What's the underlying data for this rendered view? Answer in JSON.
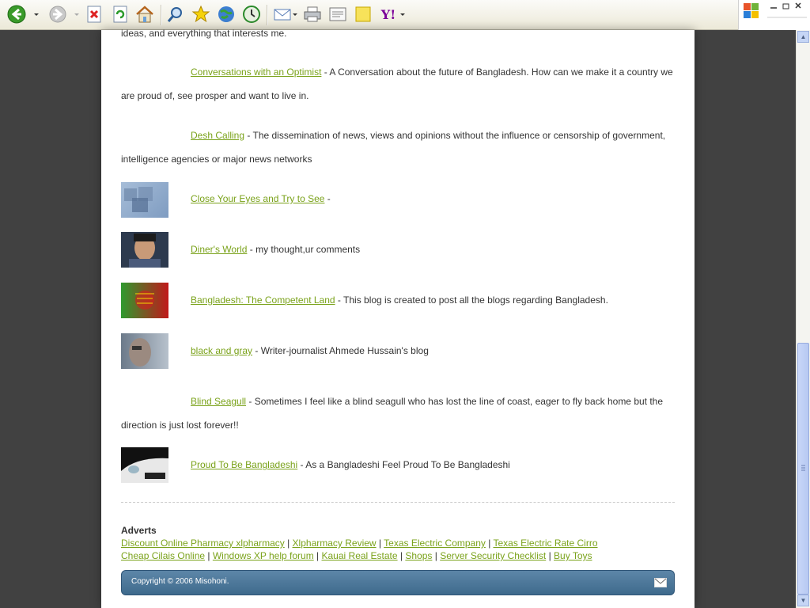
{
  "toolbar": {
    "buttons": [
      "back-icon",
      "forward-icon",
      "stop-icon",
      "refresh-icon",
      "home-icon",
      "search-icon",
      "favorites-icon",
      "media-icon",
      "history-icon",
      "mail-icon",
      "print-icon",
      "edit-icon",
      "notes-icon",
      "yahoo-icon"
    ],
    "yahoo_label": "Y!"
  },
  "cut_text": "ideas, and everything that interests me.",
  "blogs": [
    {
      "title": "Conversations with an Optimist",
      "desc": " - A Conversation about the future of Bangladesh. How can we make it a country we are proud of, see prosper and want to live in.",
      "thumb": ""
    },
    {
      "title": "Desh Calling",
      "desc": " - The dissemination of news, views and opinions without the influence or censorship of government, intelligence agencies or major news networks",
      "thumb": ""
    },
    {
      "title": "Close Your Eyes and Try to See",
      "desc": " -",
      "thumb": "squares"
    },
    {
      "title": "Diner's World",
      "desc": " - my thought,ur comments",
      "thumb": "face"
    },
    {
      "title": "Bangladesh: The Competent Land",
      "desc": " - This blog is created to post all the blogs regarding Bangladesh.",
      "thumb": "flag"
    },
    {
      "title": "black and gray",
      "desc": " - Writer-journalist Ahmede Hussain's blog",
      "thumb": "gray"
    },
    {
      "title": "Blind Seagull",
      "desc": " - Sometimes I feel like a blind seagull who has lost the line of coast, eager to fly back home but the direction is just lost forever!!",
      "thumb": ""
    },
    {
      "title": "Proud To Be Bangladeshi",
      "desc": " - As a Bangladeshi Feel Proud To Be Bangladeshi",
      "thumb": "car"
    }
  ],
  "adverts": {
    "heading": "Adverts",
    "line1": [
      "Discount Online Pharmacy xlpharmacy",
      "Xlpharmacy Review",
      "Texas Electric Company",
      "Texas Electric Rate Cirro"
    ],
    "line2": [
      "Cheap Cilais Online",
      "Windows XP help forum",
      "Kauai Real Estate",
      "Shops",
      "Server Security Checklist",
      "Buy Toys"
    ],
    "separator": " | "
  },
  "footer": {
    "copyright": "Copyright © 2006 Misohoni."
  }
}
